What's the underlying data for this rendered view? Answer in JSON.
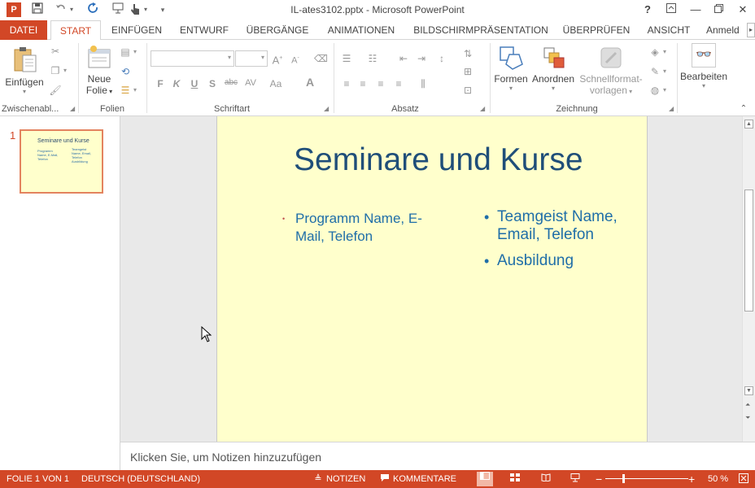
{
  "window": {
    "title": "IL-ates3102.pptx - Microsoft PowerPoint",
    "logo_letter": "P",
    "help": "?",
    "restore_ribbon": "⧉",
    "minimize": "—",
    "maximize": "❐",
    "close": "✕"
  },
  "quick_access": {
    "save": "💾",
    "undo": "↶",
    "undo_drop": "▾",
    "redo": "↻",
    "present": "⧇",
    "touch": "☝",
    "touch_drop": "▾",
    "customize": "▾"
  },
  "tabs": [
    {
      "label": "DATEI"
    },
    {
      "label": "START"
    },
    {
      "label": "EINFÜGEN"
    },
    {
      "label": "ENTWURF"
    },
    {
      "label": "ÜBERGÄNGE"
    },
    {
      "label": "ANIMATIONEN"
    },
    {
      "label": "BILDSCHIRMPRÄSENTATION"
    },
    {
      "label": "ÜBERPRÜFEN"
    },
    {
      "label": "ANSICHT"
    },
    {
      "label": "Anmeld"
    }
  ],
  "tab_scroll": "▸",
  "ribbon": {
    "groups": {
      "clipboard": "Zwischenabl...",
      "slides": "Folien",
      "font": "Schriftart",
      "paragraph": "Absatz",
      "drawing": "Zeichnung"
    },
    "paste_label": "Einfügen",
    "new_slide_label_1": "Neue",
    "new_slide_label_2": "Folie",
    "shapes_label": "Formen",
    "arrange_label": "Anordnen",
    "quickstyles_label_1": "Schnellformat-",
    "quickstyles_label_2": "vorlagen",
    "edit_label": "Bearbeiten",
    "font_buttons": [
      "F",
      "K",
      "U",
      "S",
      "abc",
      "AV",
      "Aa",
      "A"
    ]
  },
  "thumbnail": {
    "number": "1",
    "title": "Seminare und Kurse",
    "left_text": "Programm Name, E-Mail, Telefon",
    "right_items": [
      "Teamgeist Name, Email, Telefon",
      "Ausbildung"
    ]
  },
  "slide": {
    "title": "Seminare und Kurse",
    "left_bullets": [
      "Programm Name, E-Mail, Telefon"
    ],
    "right_bullets": [
      "Teamgeist Name, Email, Telefon",
      "Ausbildung"
    ]
  },
  "notes": {
    "placeholder": "Klicken Sie, um Notizen hinzuzufügen"
  },
  "status": {
    "slide_info": "FOLIE 1 VON 1",
    "language": "DEUTSCH (DEUTSCHLAND)",
    "notes_label": "NOTIZEN",
    "comments_label": "KOMMENTARE",
    "zoom_minus": "−",
    "zoom_plus": "+",
    "zoom_level": "50 %"
  },
  "colors": {
    "accent": "#d24726",
    "slide_bg": "#ffffcc",
    "title_text": "#1f4e79",
    "body_text": "#1f6ea8"
  }
}
